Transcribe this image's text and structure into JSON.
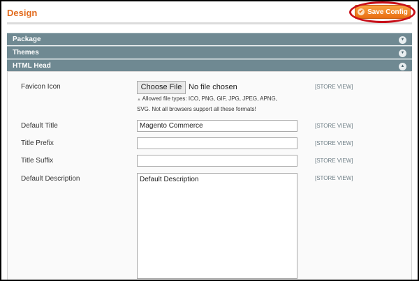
{
  "header": {
    "title": "Design",
    "save_label": "Save Config"
  },
  "sections": [
    {
      "label": "Package",
      "state": "collapsed"
    },
    {
      "label": "Themes",
      "state": "collapsed"
    },
    {
      "label": "HTML Head",
      "state": "expanded"
    }
  ],
  "form": {
    "favicon": {
      "label": "Favicon Icon",
      "button": "Choose File",
      "status": "No file chosen",
      "help1": "Allowed file types: ICO, PNG, GIF, JPG, JPEG, APNG,",
      "help2": "SVG. Not all browsers support all these formats!",
      "scope": "[STORE VIEW]"
    },
    "default_title": {
      "label": "Default Title",
      "value": "Magento Commerce",
      "scope": "[STORE VIEW]"
    },
    "title_prefix": {
      "label": "Title Prefix",
      "value": "",
      "scope": "[STORE VIEW]"
    },
    "title_suffix": {
      "label": "Title Suffix",
      "value": "",
      "scope": "[STORE VIEW]"
    },
    "default_description": {
      "label": "Default Description",
      "value": "Default Description",
      "scope": "[STORE VIEW]"
    }
  },
  "colors": {
    "accent": "#e26b1d",
    "section": "#6f8992",
    "highlight": "#c8101a"
  }
}
